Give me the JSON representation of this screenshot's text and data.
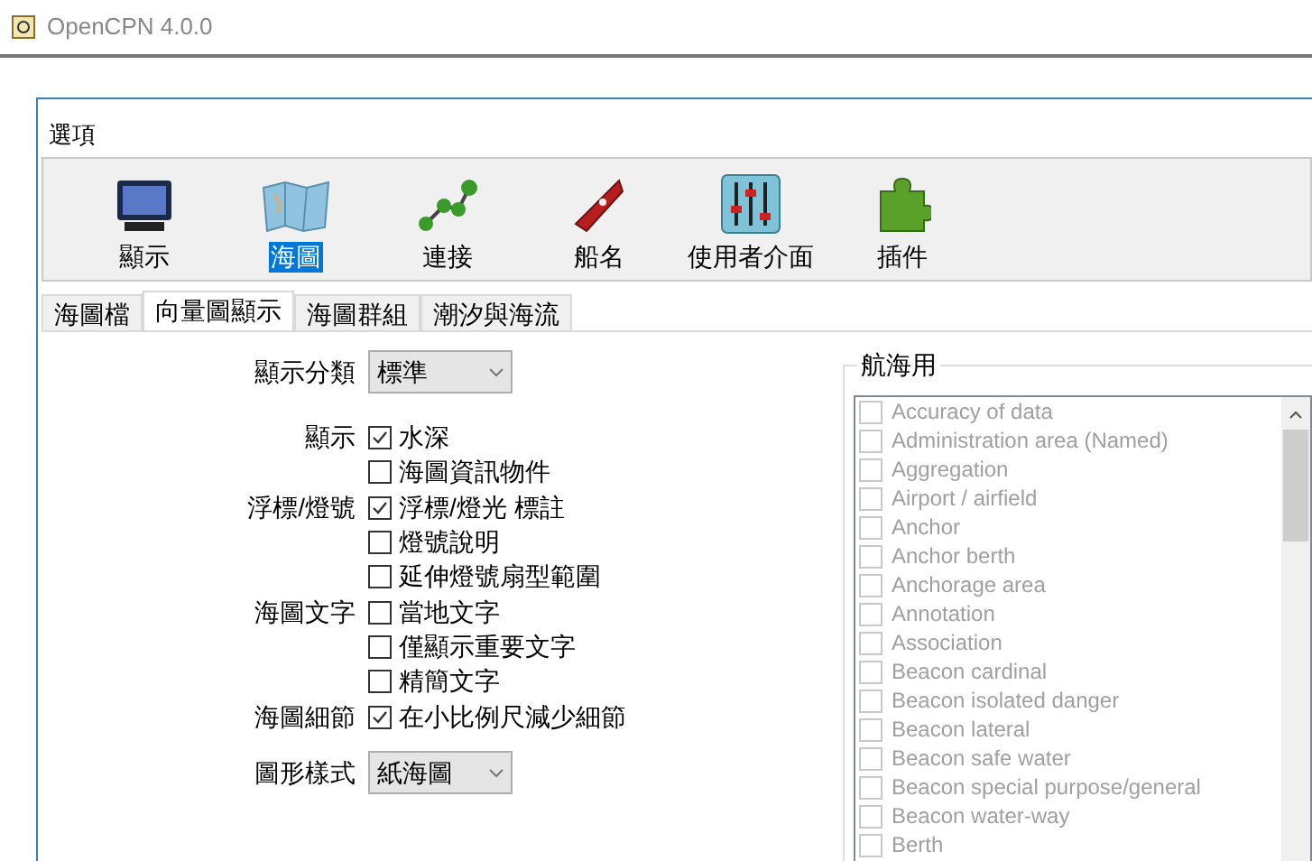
{
  "window": {
    "title": "OpenCPN 4.0.0"
  },
  "dialog": {
    "title": "選項"
  },
  "toolbar": [
    {
      "label": "顯示",
      "kind": "monitor",
      "selected": false
    },
    {
      "label": "海圖",
      "kind": "charts",
      "selected": true
    },
    {
      "label": "連接",
      "kind": "connect",
      "selected": false
    },
    {
      "label": "船名",
      "kind": "ship",
      "selected": false
    },
    {
      "label": "使用者介面",
      "kind": "sliders",
      "selected": false
    },
    {
      "label": "插件",
      "kind": "puzzle",
      "selected": false
    }
  ],
  "tabs": [
    {
      "label": "海圖檔",
      "selected": false
    },
    {
      "label": "向量圖顯示",
      "selected": true
    },
    {
      "label": "海圖群組",
      "selected": false
    },
    {
      "label": "潮汐與海流",
      "selected": false
    }
  ],
  "display_category": {
    "label": "顯示分類",
    "value": "標準"
  },
  "option_groups": [
    {
      "label": "顯示",
      "options": [
        {
          "label": "水深",
          "checked": true
        },
        {
          "label": "海圖資訊物件",
          "checked": false
        }
      ]
    },
    {
      "label": "浮標/燈號",
      "options": [
        {
          "label": "浮標/燈光 標註",
          "checked": true
        },
        {
          "label": "燈號說明",
          "checked": false
        },
        {
          "label": "延伸燈號扇型範圍",
          "checked": false
        }
      ]
    },
    {
      "label": "海圖文字",
      "options": [
        {
          "label": "當地文字",
          "checked": false
        },
        {
          "label": "僅顯示重要文字",
          "checked": false
        },
        {
          "label": "精簡文字",
          "checked": false
        }
      ]
    },
    {
      "label": "海圖細節",
      "options": [
        {
          "label": "在小比例尺減少細節",
          "checked": true
        }
      ]
    }
  ],
  "graphics_style": {
    "label": "圖形樣式",
    "value": "紙海圖"
  },
  "marine_objects": {
    "title": "航海用",
    "items": [
      {
        "label": "Accuracy of data",
        "checked": false,
        "disabled": true
      },
      {
        "label": "Administration area (Named)",
        "checked": false,
        "disabled": true
      },
      {
        "label": "Aggregation",
        "checked": false,
        "disabled": true
      },
      {
        "label": "Airport / airfield",
        "checked": false,
        "disabled": true
      },
      {
        "label": "Anchor",
        "checked": false,
        "disabled": true
      },
      {
        "label": "Anchor berth",
        "checked": false,
        "disabled": true
      },
      {
        "label": "Anchorage area",
        "checked": false,
        "disabled": true
      },
      {
        "label": "Annotation",
        "checked": false,
        "disabled": true
      },
      {
        "label": "Association",
        "checked": false,
        "disabled": true
      },
      {
        "label": "Beacon cardinal",
        "checked": false,
        "disabled": true
      },
      {
        "label": "Beacon isolated danger",
        "checked": false,
        "disabled": true
      },
      {
        "label": "Beacon lateral",
        "checked": false,
        "disabled": true
      },
      {
        "label": "Beacon safe water",
        "checked": false,
        "disabled": true
      },
      {
        "label": "Beacon special purpose/general",
        "checked": false,
        "disabled": true
      },
      {
        "label": "Beacon water-way",
        "checked": false,
        "disabled": true
      },
      {
        "label": "Berth",
        "checked": false,
        "disabled": true
      }
    ]
  }
}
